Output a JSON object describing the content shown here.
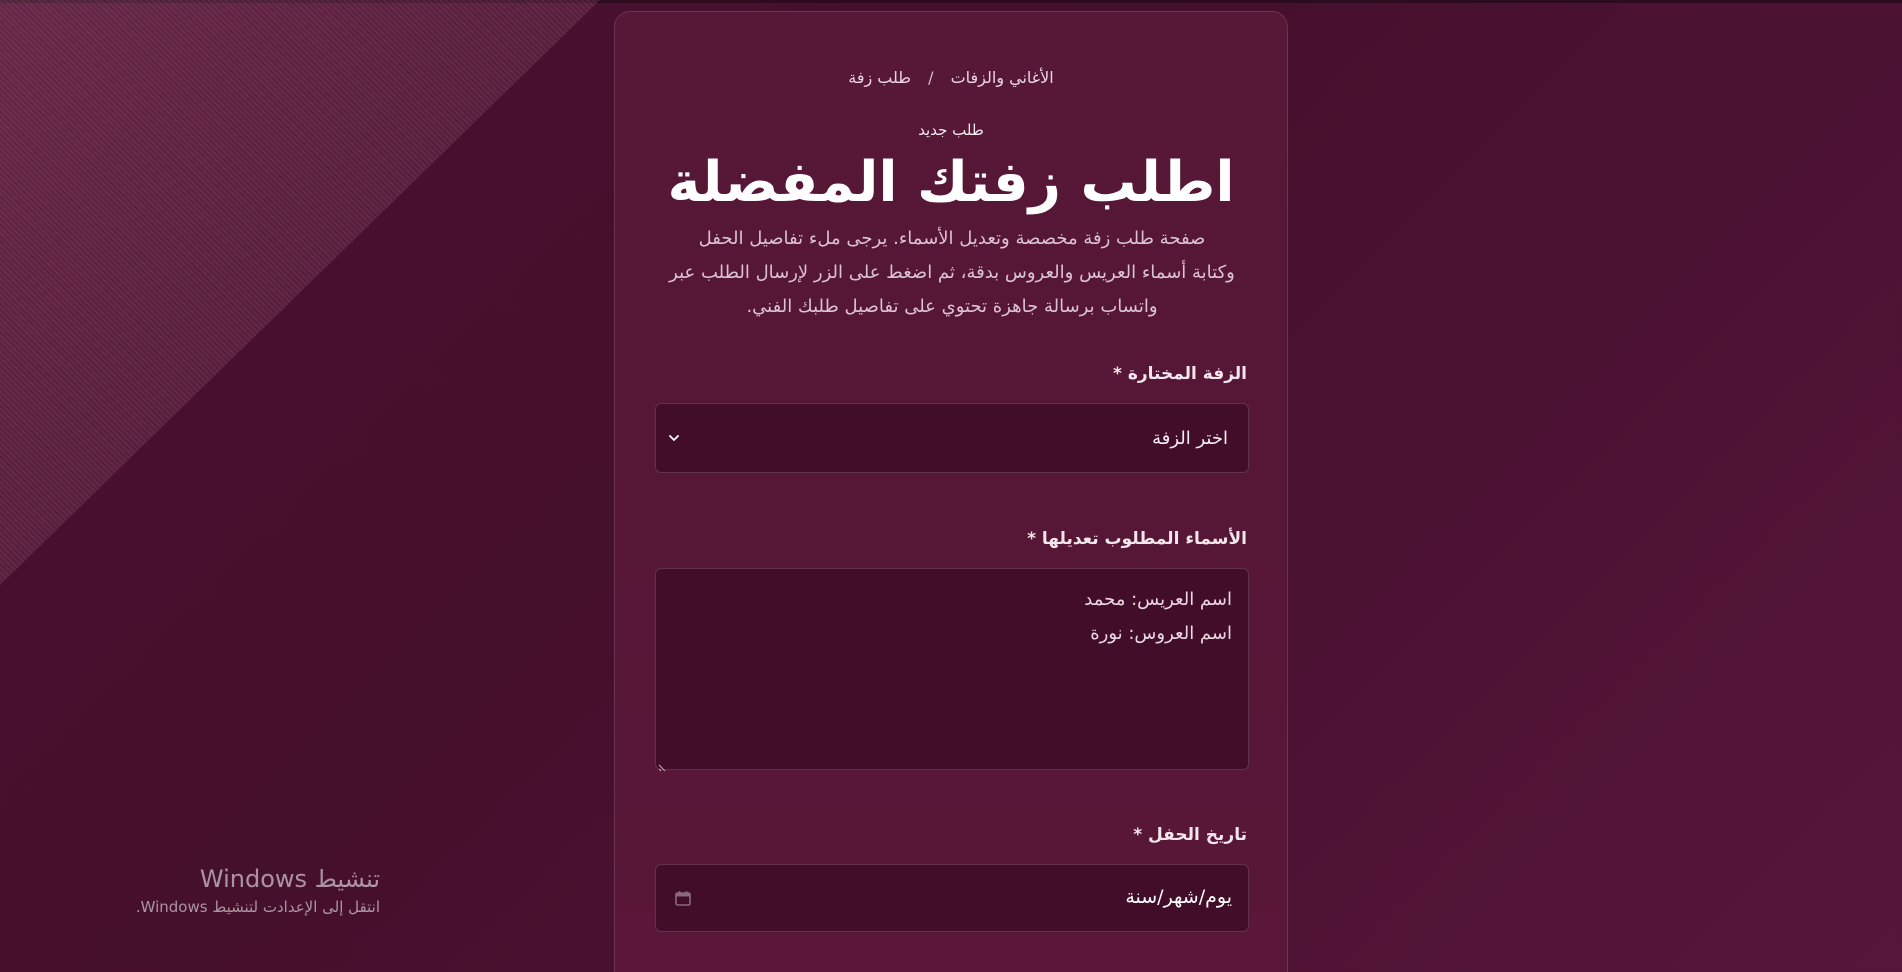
{
  "breadcrumb": {
    "parent": "الأغاني والزفات",
    "separator": "/",
    "current": "طلب زفة"
  },
  "header": {
    "eyebrow": "طلب جديد",
    "title": "اطلب زفتك المفضلة",
    "description_lines": [
      "صفحة طلب زفة مخصصة وتعديل الأسماء. يرجى ملء تفاصيل الحفل",
      "وكتابة أسماء العريس والعروس بدقة، ثم اضغط على الزر لإرسال الطلب عبر",
      "واتساب برسالة جاهزة تحتوي على تفاصيل طلبك الفني."
    ]
  },
  "form": {
    "zaffa": {
      "label": "الزفة المختارة *",
      "selected": "اختر الزفة"
    },
    "names": {
      "label": "الأسماء المطلوب تعديلها *",
      "lines": [
        "اسم العريس: محمد",
        "اسم العروس: نورة"
      ]
    },
    "date": {
      "label": "تاريخ الحفل *",
      "value": "يوم/شهر/سنة"
    }
  },
  "watermark": {
    "title": "تنشيط Windows",
    "subtitle": "انتقل إلى الإعدادت لتنشيط Windows."
  },
  "colors": {
    "background": "#4a1030",
    "card": "#571737",
    "input": "#420d29"
  },
  "icons": [
    "chevron-down-icon",
    "calendar-icon",
    "resize-grip-icon"
  ]
}
